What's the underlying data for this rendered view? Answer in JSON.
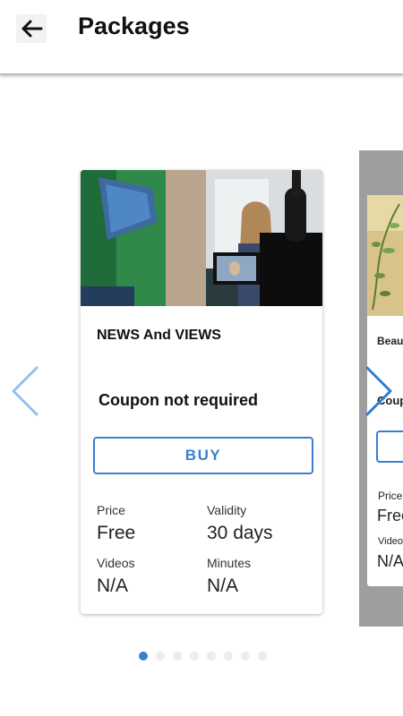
{
  "header": {
    "title": "Packages",
    "back_icon": "arrow-left-icon"
  },
  "colors": {
    "accent": "#3a80d1",
    "arrow": "#90c1f5"
  },
  "carousel": {
    "prev_icon": "chevron-left-icon",
    "next_icon": "chevron-right-icon",
    "active_index": 0,
    "page_count": 8,
    "current_card": {
      "name": "NEWS And VIEWS",
      "coupon_text": "Coupon not required",
      "buy_label": "BUY",
      "price_label": "Price",
      "price_value": "Free",
      "validity_label": "Validity",
      "validity_value": "30 days",
      "videos_label": "Videos",
      "videos_value": "N/A",
      "minutes_label": "Minutes",
      "minutes_value": "N/A"
    },
    "next_card": {
      "name": "Beaut",
      "coupon_text": "Coup",
      "price_label": "Price",
      "price_value": "Free",
      "videos_label": "Videos",
      "videos_value": "N/A"
    }
  }
}
